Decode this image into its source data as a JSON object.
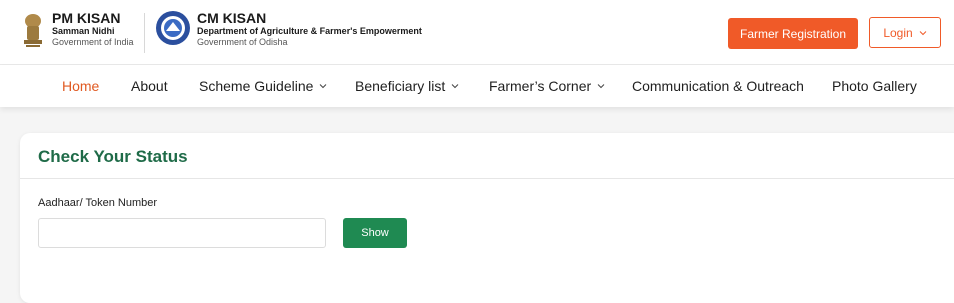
{
  "header": {
    "pm": {
      "title": "PM KISAN",
      "subtitle": "Samman Nidhi",
      "org": "Government of India"
    },
    "cm": {
      "title": "CM KISAN",
      "subtitle": "Department of Agriculture & Farmer's Empowerment",
      "org": "Government of Odisha"
    },
    "register_label": "Farmer Registration",
    "login_label": "Login"
  },
  "nav": {
    "items": [
      {
        "label": "Home",
        "active": true
      },
      {
        "label": "About"
      },
      {
        "label": "Scheme Guideline",
        "dropdown": true
      },
      {
        "label": "Beneficiary list",
        "dropdown": true
      },
      {
        "label": "Farmer’s Corner",
        "dropdown": true
      },
      {
        "label": "Communication & Outreach"
      },
      {
        "label": "Photo Gallery"
      }
    ]
  },
  "status": {
    "title": "Check Your Status",
    "field_label": "Aadhaar/ Token Number",
    "field_value": "",
    "field_placeholder": "",
    "show_label": "Show"
  },
  "colors": {
    "accent": "#f05a28",
    "nav_active": "#e05a22",
    "title_green": "#1f6b48",
    "button_green": "#1f8a52"
  }
}
